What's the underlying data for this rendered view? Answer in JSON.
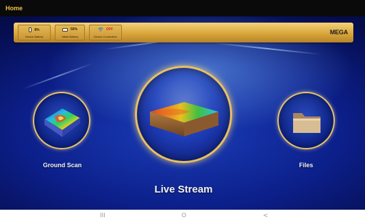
{
  "window": {
    "title": "Home"
  },
  "status_bar": {
    "device_battery": {
      "value": "8%",
      "label": "Device Battery"
    },
    "tablet_battery": {
      "value": "50%",
      "label": "Tablet Battery"
    },
    "device_connection": {
      "value": "OFF",
      "label": "Device Connection"
    },
    "brand": "MEGA"
  },
  "menu": {
    "ground_scan": {
      "label": "Ground Scan",
      "icon": "ground-scan-3d-map-icon"
    },
    "live_stream": {
      "label": "Live Stream",
      "icon": "live-stream-soil-block-icon"
    },
    "files": {
      "label": "Files",
      "icon": "folder-icon"
    }
  },
  "nav": {
    "recents": "III",
    "home": "O",
    "back": "<"
  },
  "colors": {
    "title_text": "#f0c048",
    "gold": "#e8c160",
    "background_blue": "#0c1f8a",
    "off_status": "#d42020"
  }
}
